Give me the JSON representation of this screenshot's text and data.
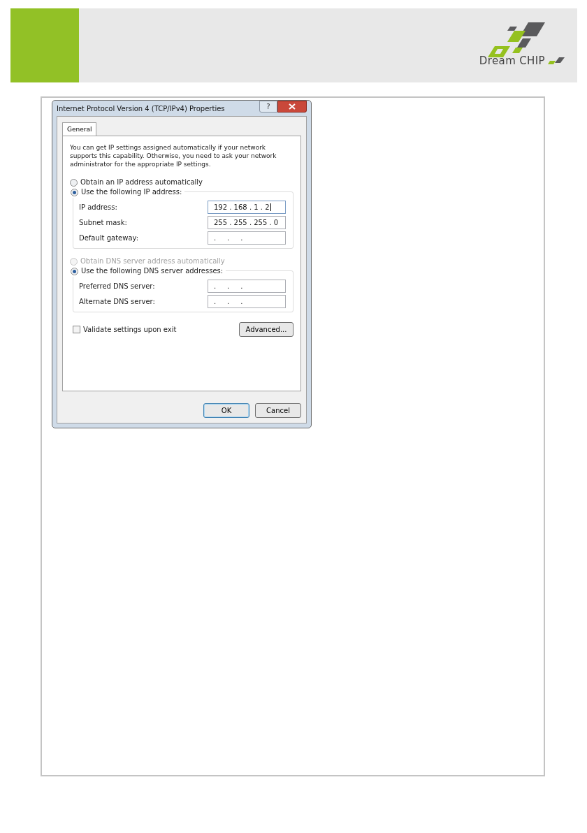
{
  "header": {
    "logo": {
      "text": "Dream CHIP"
    }
  },
  "dialog": {
    "title": "Internet Protocol Version 4 (TCP/IPv4) Properties",
    "help_button": "?",
    "tabs": [
      {
        "label": "General",
        "selected": true
      }
    ],
    "description": "You can get IP settings assigned automatically if your network supports this capability. Otherwise, you need to ask your network administrator for the appropriate IP settings.",
    "ip_options": [
      {
        "label": "Obtain an IP address automatically",
        "selected": false,
        "disabled": false
      },
      {
        "label": "Use the following IP address:",
        "selected": true,
        "disabled": false
      }
    ],
    "ip_fields": [
      {
        "label": "IP address:",
        "value": "192 . 168 . 1 . 2",
        "focused": true
      },
      {
        "label": "Subnet mask:",
        "value": "255 . 255 . 255 . 0",
        "focused": false
      },
      {
        "label": "Default gateway:",
        "value": ".     .     .",
        "focused": false
      }
    ],
    "dns_options": [
      {
        "label": "Obtain DNS server address automatically",
        "selected": false,
        "disabled": true
      },
      {
        "label": "Use the following DNS server addresses:",
        "selected": true,
        "disabled": false
      }
    ],
    "dns_fields": [
      {
        "label": "Preferred DNS server:",
        "value": ".     .     .",
        "focused": false
      },
      {
        "label": "Alternate DNS server:",
        "value": ".     .     .",
        "focused": false
      }
    ],
    "validate": {
      "label": "Validate settings upon exit",
      "checked": false
    },
    "advanced_button": "Advanced...",
    "buttons": [
      {
        "label": "OK",
        "default": true
      },
      {
        "label": "Cancel",
        "default": false
      }
    ]
  }
}
